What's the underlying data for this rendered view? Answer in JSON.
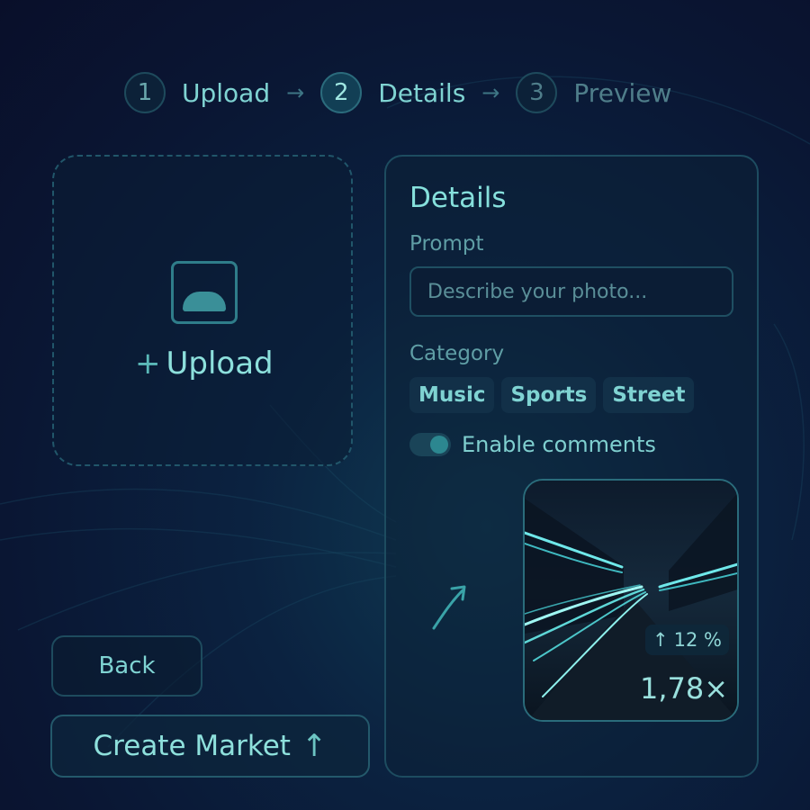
{
  "stepper": {
    "steps": [
      {
        "num": "1",
        "label": "Upload"
      },
      {
        "num": "2",
        "label": "Details"
      },
      {
        "num": "3",
        "label": "Preview"
      }
    ],
    "active_step": 2
  },
  "upload": {
    "label": "Upload"
  },
  "details": {
    "title": "Details",
    "prompt_label": "Prompt",
    "prompt_placeholder": "Describe your photo...",
    "prompt_value": "",
    "category_label": "Category",
    "categories": [
      "Music",
      "Sports",
      "Street"
    ],
    "comments_label": "Enable comments",
    "comments_enabled": true
  },
  "preview": {
    "change": "12 %",
    "multiplier": "1,78×"
  },
  "actions": {
    "back_label": "Back",
    "create_label": "Create Market"
  },
  "colors": {
    "accent": "#7fd9d6",
    "background": "#0a1633",
    "border": "#1d4c60"
  },
  "icons": [
    "image-icon",
    "plus-icon",
    "arrow-right-icon",
    "arrow-up-icon",
    "toggle-icon"
  ]
}
